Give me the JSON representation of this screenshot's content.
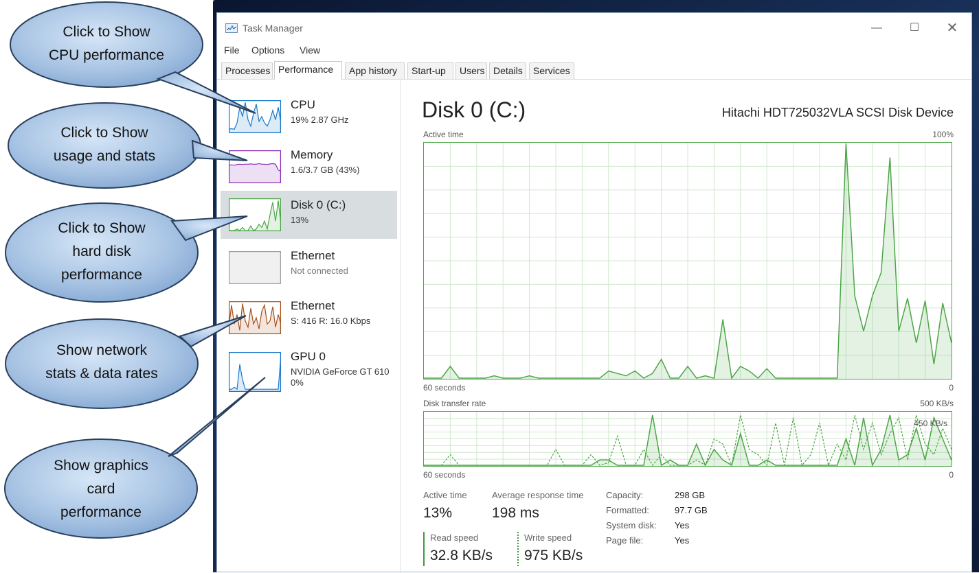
{
  "window": {
    "title": "Task Manager",
    "controls": {
      "minimize": "—",
      "maximize": "☐",
      "close": "✕"
    }
  },
  "menu": [
    "File",
    "Options",
    "View"
  ],
  "tabs": [
    {
      "label": "Processes",
      "active": false
    },
    {
      "label": "Performance",
      "active": true
    },
    {
      "label": "App history",
      "active": false
    },
    {
      "label": "Start-up",
      "active": false
    },
    {
      "label": "Users",
      "active": false
    },
    {
      "label": "Details",
      "active": false
    },
    {
      "label": "Services",
      "active": false
    }
  ],
  "sidebar": {
    "items": [
      {
        "name": "CPU",
        "stat": "19%  2.87 GHz",
        "stat2": "",
        "color": "#1979ca",
        "selected": false,
        "history": [
          0.1,
          0.12,
          0.1,
          0.3,
          0.8,
          0.5,
          0.95,
          0.4,
          0.2,
          0.6,
          0.9,
          0.35,
          0.5,
          0.3,
          0.2,
          0.4,
          0.7,
          0.4,
          0.8,
          0.3
        ]
      },
      {
        "name": "Memory",
        "stat": "1.6/3.7 GB (43%)",
        "stat2": "",
        "color": "#8b2fb6",
        "selected": false,
        "history": [
          0.55,
          0.56,
          0.55,
          0.57,
          0.58,
          0.57,
          0.58,
          0.58,
          0.59,
          0.58,
          0.58,
          0.6,
          0.58,
          0.58,
          0.57,
          0.59,
          0.6,
          0.58,
          0.4,
          0.35
        ]
      },
      {
        "name": "Disk 0 (C:)",
        "stat": "13%",
        "stat2": "",
        "color": "#4da647",
        "selected": true,
        "history": [
          0,
          0,
          0,
          0.05,
          0,
          0.1,
          0,
          0,
          0.15,
          0,
          0.05,
          0.2,
          0.1,
          0.3,
          0.05,
          0.5,
          0.9,
          0.3,
          0.95,
          0.2
        ]
      },
      {
        "name": "Ethernet",
        "stat": "Not connected",
        "stat2": "",
        "color": "#a0a0a0",
        "selected": false,
        "history": []
      },
      {
        "name": "Ethernet",
        "stat": "S: 416  R: 16.0 Kbps",
        "stat2": "",
        "color": "#a7521b",
        "selected": false,
        "history": [
          0.2,
          0.9,
          0.3,
          0.6,
          0.1,
          0.95,
          0.4,
          0.2,
          0.8,
          0.3,
          0.5,
          0.15,
          0.7,
          0.9,
          0.3,
          0.4,
          0.85,
          0.2,
          0.6,
          0.3
        ]
      },
      {
        "name": "GPU 0",
        "stat": "NVIDIA GeForce GT 610",
        "stat2": "0%",
        "color": "#1979ca",
        "selected": false,
        "history": [
          0.05,
          0.05,
          0.1,
          0.05,
          0.7,
          0.3,
          0.05,
          0.05,
          0.05,
          0.05,
          0.05,
          0.05,
          0.05,
          0.05,
          0.05,
          0.05,
          0.05,
          0.05,
          0.05,
          0.95
        ]
      }
    ]
  },
  "main": {
    "title": "Disk 0 (C:)",
    "model": "Hitachi HDT725032VLA SCSI Disk Device",
    "active_graph": {
      "label": "Active time",
      "max_label": "100%",
      "time_label": "60 seconds",
      "min_label": "0",
      "values": [
        0,
        0,
        0,
        0.05,
        0,
        0,
        0,
        0,
        0.01,
        0,
        0,
        0,
        0.01,
        0,
        0,
        0,
        0,
        0,
        0,
        0,
        0,
        0.03,
        0.02,
        0.01,
        0.03,
        0,
        0.02,
        0.08,
        0,
        0,
        0.05,
        0,
        0.01,
        0,
        0.25,
        0,
        0.05,
        0.03,
        0,
        0.04,
        0,
        0,
        0,
        0,
        0,
        0,
        0,
        0,
        1,
        0.35,
        0.2,
        0.35,
        0.45,
        0.94,
        0.2,
        0.34,
        0.15,
        0.33,
        0.06,
        0.32,
        0.15
      ]
    },
    "transfer_graph": {
      "label": "Disk transfer rate",
      "max_label": "500 KB/s",
      "scale_label": "450 KB/s",
      "time_label": "60 seconds",
      "min_label": "0",
      "read": [
        0,
        0,
        0,
        0,
        0,
        0,
        0,
        0,
        0,
        0,
        0,
        0,
        0,
        0,
        0,
        0,
        0,
        0,
        0,
        0,
        0.1,
        0.1,
        0,
        0,
        0,
        0,
        0.95,
        0,
        0.1,
        0,
        0,
        0.4,
        0,
        0.3,
        0.1,
        0,
        0.6,
        0,
        0,
        0.1,
        0,
        0,
        0,
        0,
        0,
        0,
        0,
        0,
        0.5,
        0,
        0.9,
        0,
        0.3,
        0.95,
        0.1,
        0.2,
        0.7,
        0.1,
        0.9,
        0.5,
        0.1
      ],
      "write": [
        0,
        0,
        0,
        0.2,
        0,
        0,
        0,
        0,
        0,
        0,
        0,
        0,
        0,
        0,
        0,
        0.3,
        0,
        0,
        0,
        0.2,
        0,
        0.05,
        0.55,
        0,
        0,
        0.3,
        0,
        0.2,
        0,
        0,
        0,
        0.1,
        0,
        0.5,
        0.4,
        0,
        0.95,
        0.3,
        0.2,
        0,
        0.8,
        0,
        0.9,
        0,
        0.2,
        0.8,
        0,
        0.4,
        0.1,
        0.95,
        0.3,
        0.8,
        0.2,
        0.6,
        0.9,
        0.1,
        0.95,
        0.4,
        0.2,
        0.7,
        0.3
      ]
    },
    "stats": {
      "active_time": {
        "label": "Active time",
        "value": "13%"
      },
      "avg_response": {
        "label": "Average response time",
        "value": "198 ms"
      },
      "read_speed": {
        "label": "Read speed",
        "value": "32.8 KB/s"
      },
      "write_speed": {
        "label": "Write speed",
        "value": "975 KB/s"
      }
    },
    "properties": [
      {
        "label": "Capacity:",
        "value": "298 GB"
      },
      {
        "label": "Formatted:",
        "value": "97.7 GB"
      },
      {
        "label": "System disk:",
        "value": "Yes"
      },
      {
        "label": "Page file:",
        "value": "Yes"
      }
    ]
  },
  "callouts": [
    {
      "line1": "Click to Show",
      "line2": "CPU performance",
      "line3": ""
    },
    {
      "line1": "Click to Show",
      "line2": "usage and stats",
      "line3": ""
    },
    {
      "line1": "Click to Show",
      "line2": "hard disk",
      "line3": "performance"
    },
    {
      "line1": "Show network",
      "line2": "stats & data rates",
      "line3": ""
    },
    {
      "line1": "Show graphics",
      "line2": "card",
      "line3": "performance"
    }
  ],
  "colors": {
    "disk_green": "#4da647",
    "callout_fill": "#a7c3e3",
    "callout_stroke": "#2a3f5c"
  }
}
